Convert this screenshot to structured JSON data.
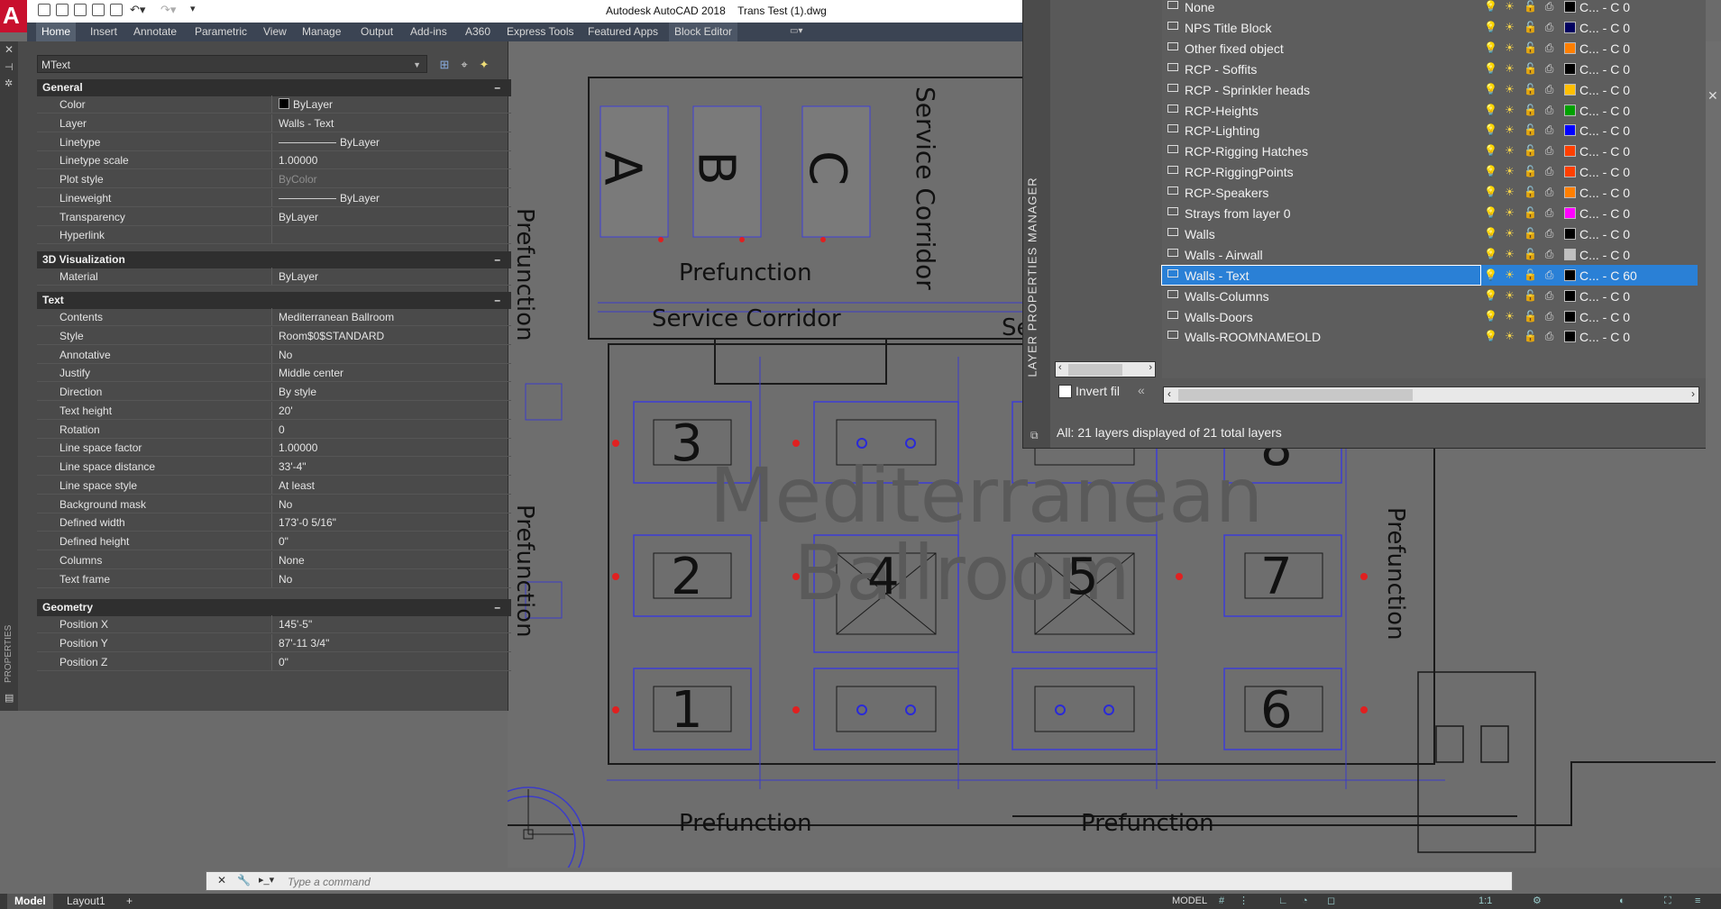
{
  "title_bar": {
    "app": "Autodesk AutoCAD 2018",
    "file": "Trans Test (1).dwg",
    "logo": "A"
  },
  "ribbon": {
    "tabs": [
      "Home",
      "Insert",
      "Annotate",
      "Parametric",
      "View",
      "Manage",
      "Output",
      "Add-ins",
      "A360",
      "Express Tools",
      "Featured Apps",
      "Block Editor"
    ],
    "active": "Home"
  },
  "properties": {
    "object_type": "MText",
    "vertical_label": "PROPERTIES",
    "sections": {
      "general": "General",
      "viz": "3D Visualization",
      "text": "Text",
      "geometry": "Geometry"
    },
    "general": [
      {
        "name": "Color",
        "value": "ByLayer"
      },
      {
        "name": "Layer",
        "value": "Walls - Text"
      },
      {
        "name": "Linetype",
        "value": "ByLayer"
      },
      {
        "name": "Linetype scale",
        "value": "1.00000"
      },
      {
        "name": "Plot style",
        "value": "ByColor"
      },
      {
        "name": "Lineweight",
        "value": "ByLayer"
      },
      {
        "name": "Transparency",
        "value": "ByLayer"
      },
      {
        "name": "Hyperlink",
        "value": ""
      }
    ],
    "viz": [
      {
        "name": "Material",
        "value": "ByLayer"
      }
    ],
    "text": [
      {
        "name": "Contents",
        "value": "Mediterranean Ballroom"
      },
      {
        "name": "Style",
        "value": "Room$0$STANDARD"
      },
      {
        "name": "Annotative",
        "value": "No"
      },
      {
        "name": "Justify",
        "value": "Middle center"
      },
      {
        "name": "Direction",
        "value": "By style"
      },
      {
        "name": "Text height",
        "value": "20'"
      },
      {
        "name": "Rotation",
        "value": "0"
      },
      {
        "name": "Line space factor",
        "value": "1.00000"
      },
      {
        "name": "Line space distance",
        "value": "33'-4\""
      },
      {
        "name": "Line space style",
        "value": "At least"
      },
      {
        "name": "Background mask",
        "value": "No"
      },
      {
        "name": "Defined width",
        "value": "173'-0 5/16\""
      },
      {
        "name": "Defined height",
        "value": "0\""
      },
      {
        "name": "Columns",
        "value": "None"
      },
      {
        "name": "Text frame",
        "value": "No"
      }
    ],
    "geometry": [
      {
        "name": "Position X",
        "value": "145'-5\""
      },
      {
        "name": "Position Y",
        "value": "87'-11 3/4\""
      },
      {
        "name": "Position Z",
        "value": "0\""
      }
    ]
  },
  "layer_manager": {
    "title": "LAYER PROPERTIES MANAGER",
    "invert_filter_label": "Invert fil",
    "status": "All: 21 layers displayed of 21 total layers",
    "layers": [
      {
        "name": "None",
        "color": "#000000",
        "ctext": "C...   - C 0"
      },
      {
        "name": "NPS Title Block",
        "color": "#000060",
        "ctext": "C...   - C 0"
      },
      {
        "name": "Other fixed object",
        "color": "#ff7f00",
        "ctext": "C...   - C 0"
      },
      {
        "name": "RCP - Soffits",
        "color": "#000000",
        "ctext": "C...   - C 0"
      },
      {
        "name": "RCP - Sprinkler heads",
        "color": "#ffbf00",
        "ctext": "C...   - C 0"
      },
      {
        "name": "RCP-Heights",
        "color": "#00a000",
        "ctext": "C...   - C 0"
      },
      {
        "name": "RCP-Lighting",
        "color": "#0000ff",
        "ctext": "C...   - C 0"
      },
      {
        "name": "RCP-Rigging Hatches",
        "color": "#ff3f00",
        "ctext": "C...   - C 0"
      },
      {
        "name": "RCP-RiggingPoints",
        "color": "#ff3f00",
        "ctext": "C...   - C 0"
      },
      {
        "name": "RCP-Speakers",
        "color": "#ff7f00",
        "ctext": "C...   - C 0"
      },
      {
        "name": "Strays from layer 0",
        "color": "#ff00ff",
        "ctext": "C...   - C 0"
      },
      {
        "name": "Walls",
        "color": "#000000",
        "ctext": "C...   - C 0"
      },
      {
        "name": "Walls - Airwall",
        "color": "#c0c0c0",
        "ctext": "C...   - C 0"
      },
      {
        "name": "Walls - Text",
        "color": "#000000",
        "ctext": "C...   - C 60",
        "selected": true
      },
      {
        "name": "Walls-Columns",
        "color": "#000000",
        "ctext": "C...   - C 0"
      },
      {
        "name": "Walls-Doors",
        "color": "#000000",
        "ctext": "C...   - C 0"
      },
      {
        "name": "Walls-ROOMNAMEOLD",
        "color": "#000000",
        "ctext": "C...   - C 0"
      }
    ]
  },
  "drawing": {
    "room_name_line1": "Mediterranean",
    "room_name_line2": "Ballroom",
    "labels": {
      "service_corridor_h": "Service Corridor",
      "service_corridor_v": "Service Corridor",
      "service_corridor_cut": "Se",
      "prefunction_top": "Prefunction",
      "prefunction_left_top": "Prefunction",
      "prefunction_left_mid": "Prefunction",
      "prefunction_right": "Prefunction",
      "prefunction_bottom_left": "Prefunction",
      "prefunction_bottom_right": "Prefunction",
      "room_a": "A",
      "room_b": "B",
      "room_c": "C",
      "sec_1": "1",
      "sec_2": "2",
      "sec_3": "3",
      "sec_4": "4",
      "sec_5": "5",
      "sec_6": "6",
      "sec_7": "7",
      "sec_8": "8"
    }
  },
  "command_line": {
    "placeholder": "Type a command"
  },
  "status_bar": {
    "tabs": [
      "Model",
      "Layout1"
    ],
    "active": "Model",
    "mode": "MODEL",
    "add": "+"
  }
}
